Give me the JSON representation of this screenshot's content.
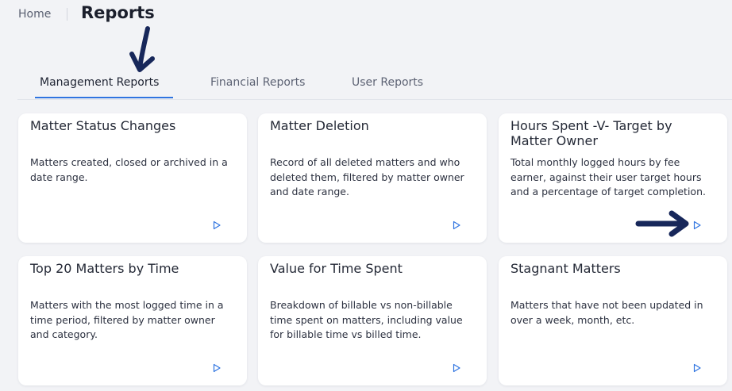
{
  "breadcrumb": {
    "home": "Home",
    "title": "Reports"
  },
  "tabs": [
    {
      "label": "Management Reports",
      "active": true
    },
    {
      "label": "Financial Reports",
      "active": false
    },
    {
      "label": "User Reports",
      "active": false
    }
  ],
  "cards": [
    {
      "title": "Matter Status Changes",
      "description": "Matters created, closed or archived in a date range."
    },
    {
      "title": "Matter Deletion",
      "description": "Record of all deleted matters and who deleted them, filtered by matter owner and date range."
    },
    {
      "title": "Hours Spent -V- Target by Matter Owner",
      "description": "Total monthly logged hours by fee earner, against their user target hours and a percentage of target completion."
    },
    {
      "title": "Top 20 Matters by Time",
      "description": "Matters with the most logged time in a time period, filtered by matter owner and category."
    },
    {
      "title": "Value for Time Spent",
      "description": "Breakdown of billable vs non-billable time spent on matters, including value for billable time vs billed time."
    },
    {
      "title": "Stagnant Matters",
      "description": "Matters that have not been updated in over a week, month, etc."
    }
  ],
  "icons": {
    "run": "play-icon",
    "annotation": "arrow-icon"
  },
  "colors": {
    "accent": "#2f74e0",
    "annotation": "#17275a",
    "background": "#f2f3f6"
  }
}
